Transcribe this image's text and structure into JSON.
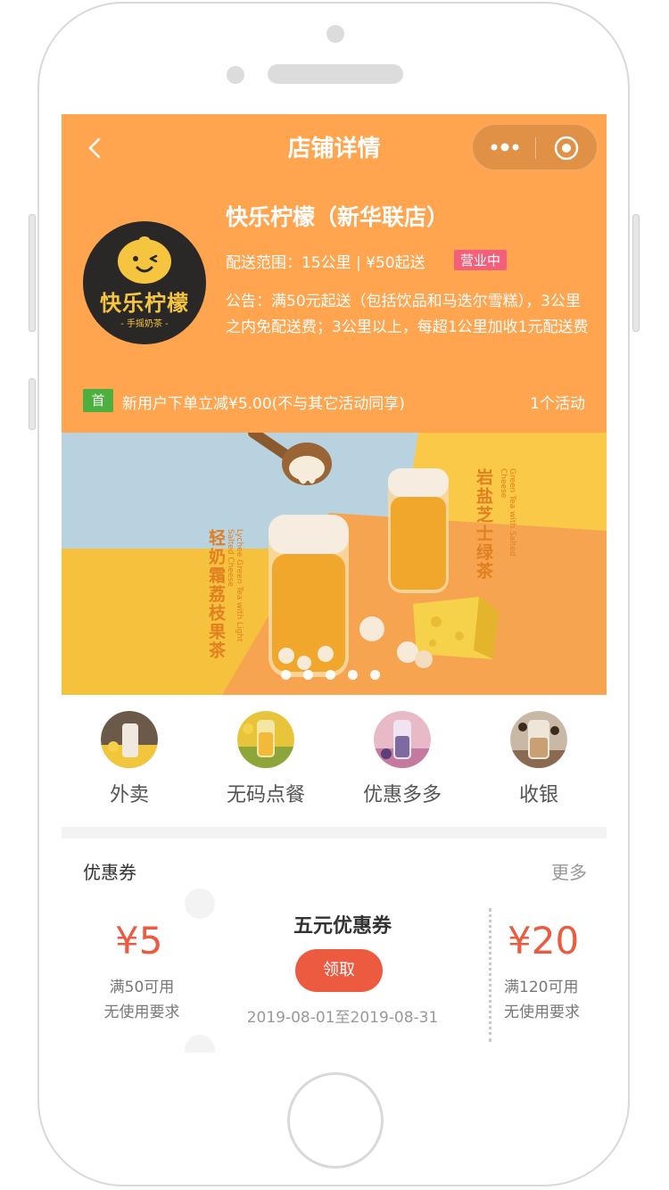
{
  "nav": {
    "title": "店铺详情"
  },
  "shop": {
    "name": "快乐柠檬（新华联店）",
    "delivery": "配送范围：15公里 | ¥50起送",
    "status": "营业中",
    "notice": "公告：满50元起送（包括饮品和马迭尔雪糕），3公里之内免配送费；3公里以上，每超1公里加收1元配送费",
    "logo_title": "快乐柠檬",
    "logo_sub": "- 手摇奶茶 -"
  },
  "promo": {
    "tag": "首",
    "text": "新用户下单立减¥5.00(不与其它活动同享)",
    "count": "1个活动"
  },
  "banner": {
    "left_cn": "轻奶霜荔枝果茶",
    "left_en": "Lychee Green Tea with Light Salted Cheese",
    "right_cn": "岩盐芝士绿茶",
    "right_en": "Green Tea with Salted Cheese",
    "slides": 5,
    "active_slide": 2
  },
  "quicknav": [
    {
      "label": "外卖",
      "icon": "takeout-icon"
    },
    {
      "label": "无码点餐",
      "icon": "scan-order-icon"
    },
    {
      "label": "优惠多多",
      "icon": "discount-icon"
    },
    {
      "label": "收银",
      "icon": "checkout-icon"
    }
  ],
  "coupons": {
    "title": "优惠券",
    "more": "更多",
    "left": {
      "amount": "¥5",
      "cond": "满50可用",
      "note": "无使用要求"
    },
    "center": {
      "name": "五元优惠券",
      "button": "领取",
      "date": "2019-08-01至2019-08-31"
    },
    "right": {
      "amount": "¥20",
      "cond": "满120可用",
      "note": "无使用要求"
    }
  },
  "colors": {
    "header": "#ffa550",
    "accent": "#ec5a3f",
    "badge": "#f2607c",
    "tag": "#4caf3e"
  }
}
